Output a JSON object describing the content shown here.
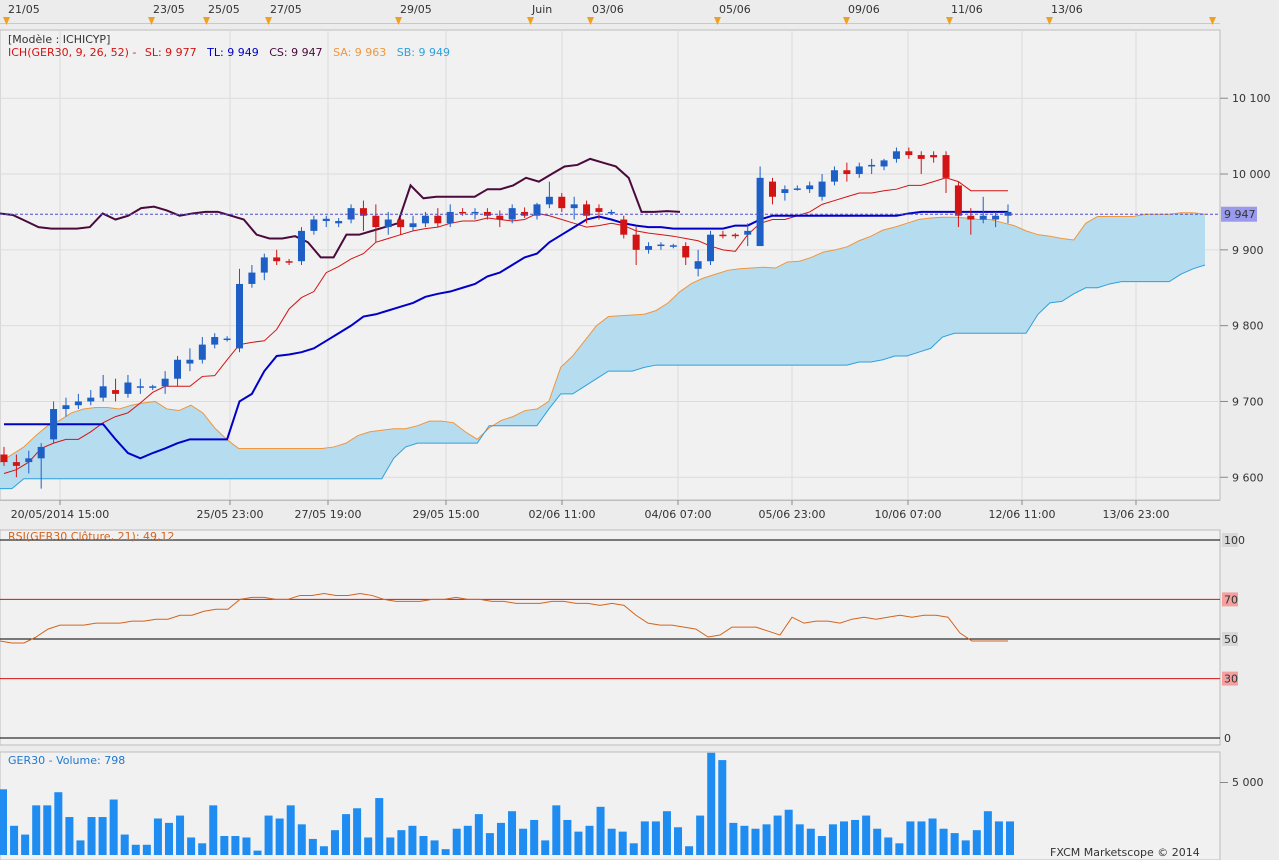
{
  "top_dates": [
    "21/05",
    "23/05",
    "25/05",
    "27/05",
    "29/05",
    "Juin",
    "03/06",
    "05/06",
    "09/06",
    "11/06",
    "13/06"
  ],
  "main": {
    "model_label": "[Modèle : ICHICYP]",
    "ichimoku": {
      "name": "ICH(GER30, 9, 26, 52) -",
      "sl": "SL: 9 977",
      "tl": "TL: 9 949",
      "cs": "CS: 9 947",
      "sa": "SA: 9 963",
      "sb": "SB: 9 949"
    },
    "price_ticks": [
      "10 100",
      "10 000",
      "9 900",
      "9 800",
      "9 700",
      "9 600"
    ],
    "current_price": "9 947",
    "x_labels": [
      "20/05/2014 15:00",
      "25/05 23:00",
      "27/05 19:00",
      "29/05 15:00",
      "02/06 11:00",
      "04/06 07:00",
      "05/06 23:00",
      "10/06 07:00",
      "12/06 11:00",
      "13/06 23:00"
    ]
  },
  "rsi": {
    "title": "RSI(GER30 Clôture, 21): 49,12",
    "levels": [
      "100",
      "70",
      "50",
      "30",
      "0"
    ]
  },
  "volume": {
    "title": "GER30 - Volume: 798",
    "tick": "5 000"
  },
  "footer": "FXCM Marketscope © 2014",
  "colors": {
    "bull": "#1e5fc6",
    "bear": "#d21414",
    "tenkan": "#0000c8",
    "kijun": "#d21414",
    "chikou": "#4a0a3c",
    "senkou_a": "#f0963c",
    "senkou_b": "#2ea0dc",
    "cloud": "#b6dcf0",
    "rsi": "#d2641e",
    "volume": "#1e8cf0"
  },
  "chart_data": [
    {
      "type": "candlestick",
      "title": "GER30",
      "ylim": [
        9570,
        10190
      ],
      "candles": [
        [
          9630,
          9640,
          9615,
          9620
        ],
        [
          9620,
          9630,
          9600,
          9615
        ],
        [
          9620,
          9635,
          9605,
          9625
        ],
        [
          9625,
          9645,
          9585,
          9640
        ],
        [
          9650,
          9700,
          9645,
          9690
        ],
        [
          9690,
          9705,
          9680,
          9695
        ],
        [
          9695,
          9710,
          9690,
          9700
        ],
        [
          9700,
          9715,
          9695,
          9705
        ],
        [
          9705,
          9735,
          9700,
          9720
        ],
        [
          9715,
          9730,
          9700,
          9710
        ],
        [
          9710,
          9735,
          9705,
          9725
        ],
        [
          9720,
          9730,
          9710,
          9720
        ],
        [
          9718,
          9722,
          9715,
          9720
        ],
        [
          9720,
          9740,
          9710,
          9730
        ],
        [
          9730,
          9760,
          9720,
          9755
        ],
        [
          9750,
          9770,
          9740,
          9755
        ],
        [
          9755,
          9785,
          9750,
          9775
        ],
        [
          9775,
          9790,
          9770,
          9785
        ],
        [
          9782,
          9786,
          9779,
          9783
        ],
        [
          9770,
          9875,
          9765,
          9855
        ],
        [
          9855,
          9880,
          9850,
          9870
        ],
        [
          9870,
          9895,
          9860,
          9890
        ],
        [
          9890,
          9900,
          9880,
          9885
        ],
        [
          9885,
          9888,
          9880,
          9884
        ],
        [
          9885,
          9930,
          9880,
          9925
        ],
        [
          9925,
          9945,
          9920,
          9940
        ],
        [
          9938,
          9945,
          9930,
          9941
        ],
        [
          9935,
          9942,
          9930,
          9938
        ],
        [
          9940,
          9960,
          9935,
          9955
        ],
        [
          9955,
          9965,
          9925,
          9945
        ],
        [
          9945,
          9960,
          9910,
          9930
        ],
        [
          9930,
          9950,
          9920,
          9940
        ],
        [
          9940,
          9942,
          9920,
          9930
        ],
        [
          9930,
          9945,
          9925,
          9935
        ],
        [
          9935,
          9950,
          9930,
          9945
        ],
        [
          9945,
          9955,
          9930,
          9935
        ],
        [
          9935,
          9960,
          9930,
          9950
        ],
        [
          9950,
          9955,
          9945,
          9949
        ],
        [
          9948,
          9955,
          9940,
          9950
        ],
        [
          9950,
          9955,
          9940,
          9945
        ],
        [
          9945,
          9952,
          9930,
          9940
        ],
        [
          9940,
          9960,
          9935,
          9955
        ],
        [
          9950,
          9956,
          9942,
          9945
        ],
        [
          9945,
          9962,
          9940,
          9960
        ],
        [
          9960,
          9990,
          9955,
          9970
        ],
        [
          9970,
          9975,
          9950,
          9955
        ],
        [
          9955,
          9970,
          9940,
          9960
        ],
        [
          9960,
          9965,
          9935,
          9945
        ],
        [
          9955,
          9960,
          9940,
          9950
        ],
        [
          9950,
          9953,
          9947,
          9950
        ],
        [
          9940,
          9945,
          9915,
          9920
        ],
        [
          9920,
          9930,
          9880,
          9900
        ],
        [
          9900,
          9910,
          9895,
          9905
        ],
        [
          9905,
          9910,
          9900,
          9907
        ],
        [
          9905,
          9908,
          9902,
          9906
        ],
        [
          9905,
          9910,
          9880,
          9890
        ],
        [
          9875,
          9900,
          9865,
          9885
        ],
        [
          9885,
          9925,
          9880,
          9920
        ],
        [
          9920,
          9925,
          9915,
          9918
        ],
        [
          9920,
          9922,
          9915,
          9919
        ],
        [
          9920,
          9935,
          9905,
          9925
        ],
        [
          9905,
          10010,
          9905,
          9995
        ],
        [
          9990,
          9995,
          9960,
          9970
        ],
        [
          9975,
          9985,
          9965,
          9980
        ],
        [
          9980,
          9985,
          9978,
          9981
        ],
        [
          9980,
          9990,
          9975,
          9985
        ],
        [
          9970,
          10000,
          9965,
          9990
        ],
        [
          9990,
          10010,
          9985,
          10005
        ],
        [
          10005,
          10015,
          9990,
          10000
        ],
        [
          10000,
          10015,
          9995,
          10010
        ],
        [
          10010,
          10020,
          10000,
          10012
        ],
        [
          10010,
          10020,
          10005,
          10018
        ],
        [
          10020,
          10035,
          10015,
          10030
        ],
        [
          10030,
          10035,
          10020,
          10025
        ],
        [
          10025,
          10030,
          10000,
          10020
        ],
        [
          10025,
          10030,
          10015,
          10022
        ],
        [
          10025,
          10030,
          9975,
          9995
        ],
        [
          9985,
          9990,
          9930,
          9945
        ],
        [
          9945,
          9955,
          9920,
          9940
        ],
        [
          9940,
          9970,
          9935,
          9945
        ],
        [
          9940,
          9950,
          9930,
          9945
        ],
        [
          9945,
          9960,
          9935,
          9950
        ]
      ],
      "tenkan": [
        9670,
        9670,
        9670,
        9670,
        9670,
        9670,
        9670,
        9670,
        9670,
        9650,
        9632,
        9625,
        9632,
        9638,
        9645,
        9650,
        9650,
        9650,
        9650,
        9700,
        9710,
        9740,
        9760,
        9762,
        9765,
        9770,
        9780,
        9790,
        9800,
        9812,
        9815,
        9820,
        9825,
        9830,
        9838,
        9842,
        9845,
        9850,
        9855,
        9865,
        9870,
        9880,
        9890,
        9895,
        9910,
        9920,
        9930,
        9940,
        9944,
        9940,
        9935,
        9932,
        9930,
        9930,
        9928,
        9928,
        9928,
        9928,
        9928,
        9932,
        9932,
        9940,
        9945,
        9945,
        9945,
        9945,
        9945,
        9945,
        9945,
        9945,
        9945,
        9945,
        9945,
        9948,
        9950,
        9950,
        9950,
        9950,
        9950,
        9950,
        9950,
        9950
      ],
      "kijun": [
        9605,
        9610,
        9620,
        9638,
        9645,
        9650,
        9650,
        9660,
        9672,
        9680,
        9685,
        9698,
        9712,
        9720,
        9720,
        9720,
        9733,
        9734,
        9755,
        9775,
        9778,
        9780,
        9795,
        9822,
        9837,
        9845,
        9870,
        9878,
        9888,
        9895,
        9910,
        9915,
        9920,
        9925,
        9928,
        9930,
        9935,
        9938,
        9938,
        9942,
        9940,
        9938,
        9940,
        9948,
        9945,
        9940,
        9935,
        9930,
        9932,
        9935,
        9932,
        9925,
        9922,
        9920,
        9918,
        9915,
        9912,
        9905,
        9900,
        9898,
        9920,
        9935,
        9940,
        9940,
        9945,
        9950,
        9960,
        9965,
        9970,
        9975,
        9975,
        9978,
        9980,
        9985,
        9985,
        9990,
        9995,
        9990,
        9978,
        9978,
        9978,
        9978
      ],
      "chikou": [
        9948,
        9946,
        9938,
        9930,
        9928,
        9928,
        9928,
        9930,
        9948,
        9940,
        9945,
        9955,
        9957,
        9952,
        9945,
        9948,
        9950,
        9950,
        9945,
        9940,
        9920,
        9915,
        9915,
        9918,
        9910,
        9890,
        9890,
        9920,
        9920,
        9925,
        9930,
        9935,
        9985,
        9968,
        9970,
        9970,
        9970,
        9970,
        9980,
        9980,
        9985,
        9995,
        9990,
        10000,
        10010,
        10012,
        10020,
        10015,
        10010,
        9995,
        9950,
        9950,
        9951,
        9950
      ],
      "senkou_a": [
        9620,
        9630,
        9640,
        9655,
        9668,
        9675,
        9685,
        9690,
        9692,
        9692,
        9690,
        9695,
        9698,
        9700,
        9690,
        9688,
        9695,
        9685,
        9665,
        9650,
        9638,
        9638,
        9638,
        9638,
        9638,
        9638,
        9638,
        9638,
        9640,
        9645,
        9655,
        9660,
        9662,
        9664,
        9664,
        9668,
        9674,
        9674,
        9672,
        9660,
        9650,
        9665,
        9675,
        9680,
        9688,
        9690,
        9700,
        9745,
        9760,
        9780,
        9800,
        9812,
        9813,
        9814,
        9815,
        9820,
        9830,
        9845,
        9856,
        9863,
        9868,
        9873,
        9875,
        9876,
        9877,
        9876,
        9884,
        9885,
        9890,
        9897,
        9900,
        9904,
        9912,
        9918,
        9926,
        9930,
        9935,
        9940,
        9942,
        9943,
        9943,
        9942,
        9940,
        9940,
        9936,
        9932,
        9925,
        9920,
        9918,
        9915,
        9913,
        9935,
        9944,
        9944,
        9944,
        9944,
        9947,
        9947,
        9947,
        9949,
        9949,
        9947
      ],
      "senkou_b": [
        9585,
        9585,
        9598,
        9598,
        9598,
        9598,
        9598,
        9598,
        9598,
        9598,
        9598,
        9598,
        9598,
        9598,
        9598,
        9598,
        9598,
        9598,
        9598,
        9598,
        9598,
        9598,
        9598,
        9598,
        9598,
        9598,
        9598,
        9598,
        9598,
        9598,
        9598,
        9598,
        9598,
        9625,
        9640,
        9645,
        9645,
        9645,
        9645,
        9645,
        9645,
        9668,
        9668,
        9668,
        9668,
        9668,
        9690,
        9710,
        9710,
        9720,
        9730,
        9740,
        9740,
        9740,
        9745,
        9748,
        9748,
        9748,
        9748,
        9748,
        9748,
        9748,
        9748,
        9748,
        9748,
        9748,
        9748,
        9748,
        9748,
        9748,
        9748,
        9748,
        9752,
        9752,
        9755,
        9760,
        9760,
        9765,
        9770,
        9785,
        9790,
        9790,
        9790,
        9790,
        9790,
        9790,
        9790,
        9815,
        9830,
        9832,
        9842,
        9850,
        9850,
        9855,
        9858,
        9858,
        9858,
        9858,
        9858,
        9868,
        9875,
        9880,
        9888
      ]
    },
    {
      "type": "line",
      "title": "RSI(GER30 Clôture, 21): 49,12",
      "ylim": [
        0,
        100
      ],
      "levels": [
        100,
        70,
        50,
        30,
        0
      ],
      "values": [
        49,
        48,
        48,
        51,
        55,
        57,
        57,
        57,
        58,
        58,
        58,
        59,
        59,
        60,
        60,
        62,
        62,
        64,
        65,
        65,
        70,
        71,
        71,
        70,
        70,
        72,
        72,
        73,
        72,
        72,
        73,
        72,
        70,
        69,
        69,
        69,
        70,
        70,
        71,
        70,
        70,
        69,
        69,
        68,
        68,
        68,
        69,
        69,
        68,
        68,
        67,
        68,
        67,
        62,
        58,
        57,
        57,
        56,
        55,
        51,
        52,
        56,
        56,
        56,
        54,
        52,
        61,
        58,
        59,
        59,
        58,
        60,
        61,
        60,
        61,
        62,
        61,
        62,
        62,
        61,
        53,
        49,
        49,
        49,
        49
      ]
    },
    {
      "type": "bar",
      "title": "GER30 - Volume: 798",
      "ylim": [
        0,
        7000
      ],
      "values": [
        4500,
        2000,
        1400,
        3400,
        3400,
        4300,
        2600,
        1000,
        2600,
        2600,
        3800,
        1400,
        700,
        700,
        2500,
        2200,
        2700,
        1200,
        800,
        3400,
        1300,
        1300,
        1200,
        300,
        2700,
        2500,
        3400,
        2100,
        1100,
        600,
        1700,
        2800,
        3200,
        1200,
        3900,
        1200,
        1700,
        2000,
        1300,
        1000,
        400,
        1800,
        2000,
        2800,
        1500,
        2200,
        3000,
        1800,
        2400,
        1000,
        3400,
        2400,
        1600,
        2000,
        3300,
        1800,
        1600,
        800,
        2300,
        2300,
        3000,
        1900,
        600,
        2700,
        7000,
        6500,
        2200,
        2000,
        1800,
        2100,
        2700,
        3100,
        2100,
        1800,
        1300,
        2100,
        2300,
        2400,
        2700,
        1800,
        1200,
        800,
        2300,
        2300,
        2500,
        1800,
        1500,
        1000,
        1700,
        3000,
        2300,
        2300
      ]
    }
  ]
}
